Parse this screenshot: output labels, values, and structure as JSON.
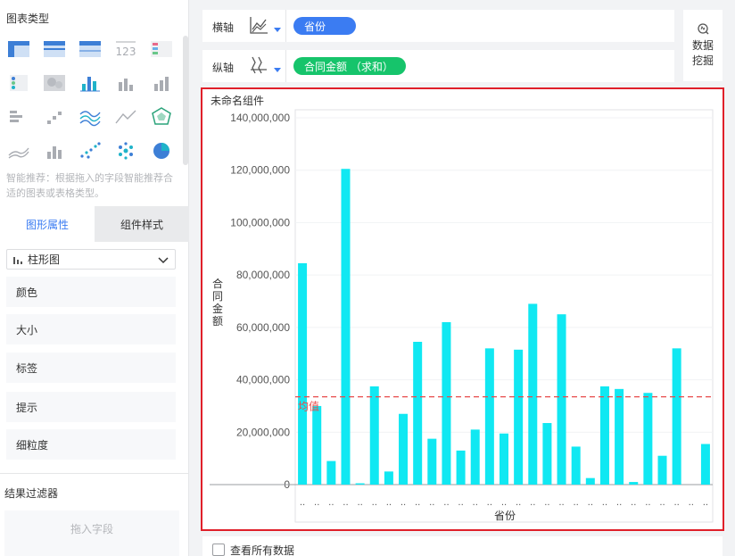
{
  "left": {
    "chart_types_title": "图表类型",
    "chart_type_icons": [
      "cross-table-icon",
      "grouped-table-icon",
      "detail-table-icon",
      "kpi-number-icon",
      "colored-kpi-table-icon",
      "indicator-card-icon",
      "heatmap-icon",
      "column-chart-icon",
      "stacked-column-icon",
      "percent-column-icon",
      "bar-chart-icon",
      "scatter-column-icon",
      "multi-line-icon",
      "line-chart-icon",
      "radar-chart-icon",
      "area-chart-icon",
      "column-chart-alt-icon",
      "scatter-plot-icon",
      "bubble-chart-icon",
      "pie-chart-icon"
    ],
    "kpi_label": "123",
    "hint": "智能推荐：根据拖入的字段智能推荐合适的图表或表格类型。",
    "tabs": {
      "attributes": "图形属性",
      "style": "组件样式"
    },
    "chart_select": "柱形图",
    "props": [
      "颜色",
      "大小",
      "标签",
      "提示",
      "细粒度"
    ],
    "filter_title": "结果过滤器",
    "drop_placeholder": "拖入字段"
  },
  "axes": {
    "x_label": "横轴",
    "x_field": "省份",
    "y_label": "纵轴",
    "y_field": "合同金额 （求和）"
  },
  "mining": {
    "label": "数据挖掘"
  },
  "widget": {
    "title": "未命名组件",
    "show_all": "查看所有数据"
  },
  "colors": {
    "accent": "#3b7cf2",
    "bar": "#10e8f2",
    "green": "#16c46b",
    "mean_line": "#e84a4a",
    "frame": "#e0202a"
  },
  "chart_data": {
    "type": "bar",
    "title": "",
    "xlabel": "省份",
    "ylabel": "合同金额",
    "ylim": [
      0,
      140000000
    ],
    "yticks": [
      "140,000,000",
      "120,000,000",
      "100,000,000",
      "80,000,000",
      "60,000,000",
      "40,000,000",
      "20,000,000",
      "0"
    ],
    "category_tick": "..",
    "mean_label": "均值",
    "mean_value": 33500000,
    "values": [
      84500000,
      30000000,
      9000000,
      120500000,
      500000,
      37500000,
      5000000,
      27000000,
      54500000,
      17500000,
      62000000,
      13000000,
      21000000,
      52000000,
      19500000,
      51500000,
      69000000,
      23500000,
      65000000,
      14500000,
      2500000,
      37500000,
      36500000,
      1000000,
      35000000,
      11000000,
      52000000,
      0,
      15500000
    ]
  }
}
